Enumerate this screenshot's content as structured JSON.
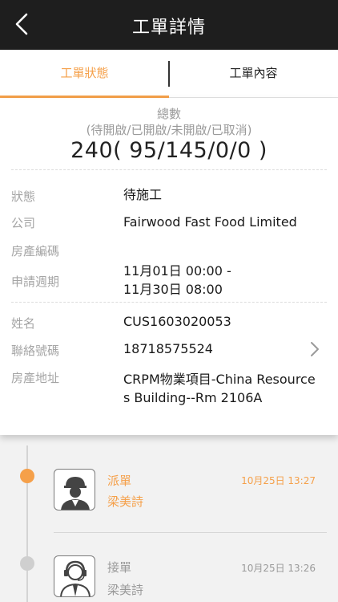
{
  "nav": {
    "title": "工單詳情"
  },
  "tabs": [
    {
      "label": "工單狀態"
    },
    {
      "label": "工單內容"
    }
  ],
  "summary": {
    "total_label": "總數",
    "legend_label": "(待開啟/已開啟/未開啟/已取消)",
    "counts": "240( 95/145/0/0 )"
  },
  "details": {
    "status": {
      "label": "狀態",
      "value": "待施工"
    },
    "company": {
      "label": "公司",
      "value": "Fairwood Fast Food Limited"
    },
    "property_code": {
      "label": "房產編碼",
      "value": ""
    },
    "period": {
      "label": "申請週期",
      "line1": "11月01日 00:00 -",
      "line2": "11月30日 08:00"
    },
    "name": {
      "label": "姓名",
      "value": "CUS1603020053"
    },
    "phone": {
      "label": "聯絡號碼",
      "value": "18718575524"
    },
    "address": {
      "label": "房產地址",
      "line1": "CRPM物業項目-China Resource",
      "line2": "s Building--Rm 2106A"
    }
  },
  "timeline": [
    {
      "title": "派單",
      "name": "梁美詩",
      "time": "10月25日 13:27",
      "status_color": "#f5a04a",
      "icon": "worker-avatar-icon"
    },
    {
      "title": "接單",
      "name": "梁美詩",
      "time": "10月25日 13:26",
      "status_color": "#cfcfcf",
      "icon": "support-agent-avatar-icon"
    }
  ]
}
